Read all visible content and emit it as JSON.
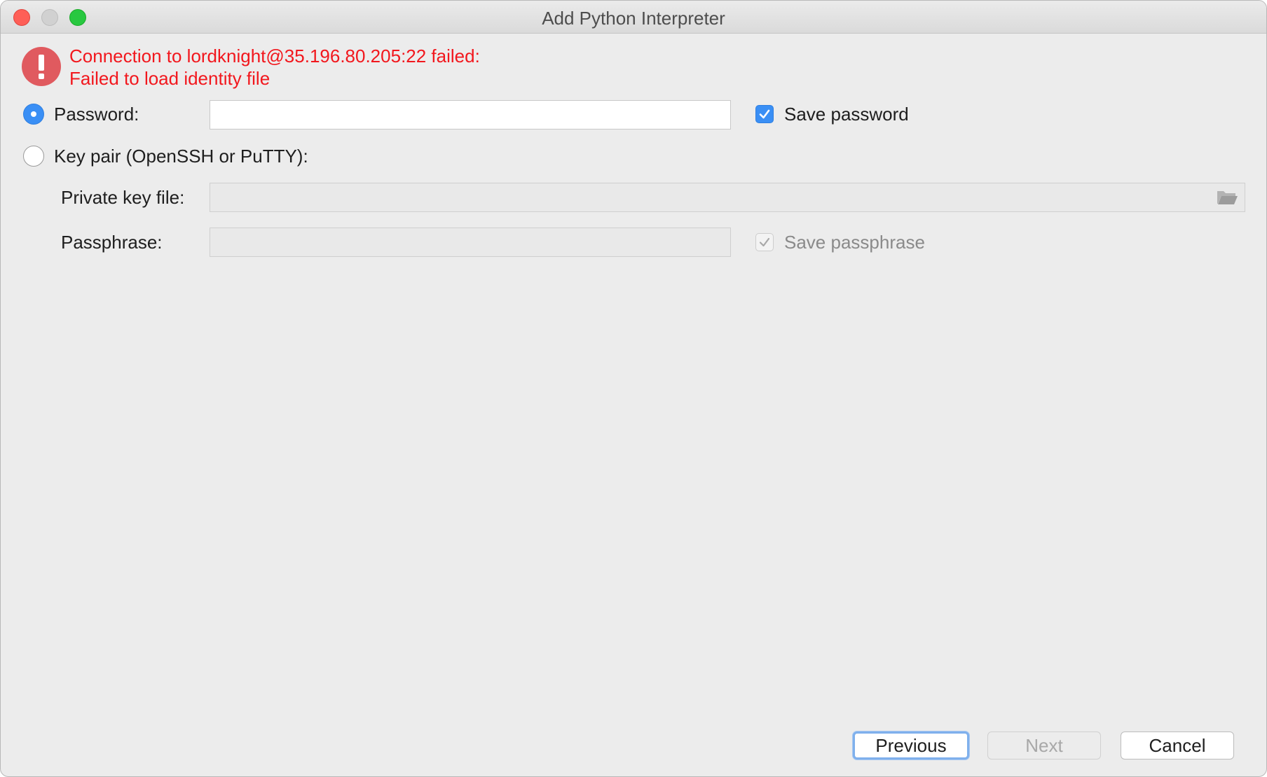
{
  "window": {
    "title": "Add Python Interpreter"
  },
  "error": {
    "icon": "error-exclamation-icon",
    "line1": "Connection to lordknight@35.196.80.205:22 failed:",
    "line2": "Failed to load identity file",
    "color": "#f2171d"
  },
  "auth": {
    "password_label": "Password:",
    "password_value": "",
    "password_selected": true,
    "save_password_label": "Save password",
    "save_password_checked": true,
    "keypair_label": "Key pair (OpenSSH or PuTTY):",
    "keypair_selected": false,
    "private_key_label": "Private key file:",
    "private_key_value": "",
    "passphrase_label": "Passphrase:",
    "passphrase_value": "",
    "save_passphrase_label": "Save passphrase",
    "save_passphrase_checked": true,
    "browse_icon": "folder-open-icon"
  },
  "buttons": {
    "previous": "Previous",
    "next": "Next",
    "cancel": "Cancel"
  },
  "colors": {
    "accent": "#3a8ff5",
    "window_bg": "#ececec"
  }
}
